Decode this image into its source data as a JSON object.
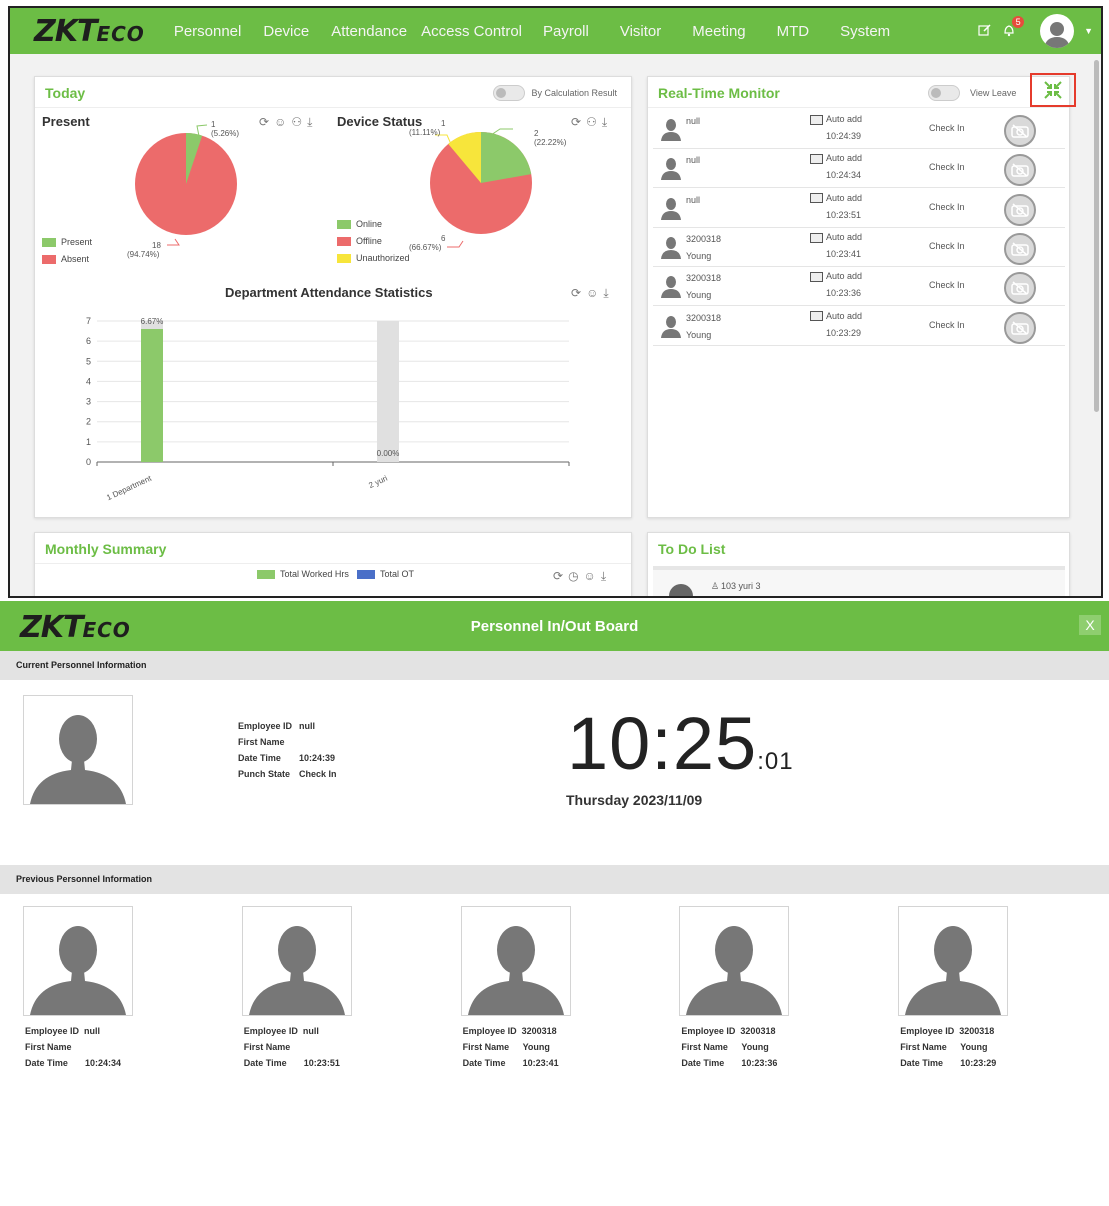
{
  "nav": {
    "logo_main": "ZKT",
    "logo_sub": "ECO",
    "items": [
      "Personnel",
      "Device",
      "Attendance",
      "Access Control",
      "Payroll",
      "Visitor",
      "Meeting",
      "MTD",
      "System"
    ],
    "notification_count": "5"
  },
  "today": {
    "title": "Today",
    "toggle_label": "By Calculation Result",
    "present": {
      "heading": "Present",
      "slices": [
        {
          "label": "1\n(5.26%)",
          "value": 1
        },
        {
          "label": "18\n(94.74%)",
          "value": 18
        }
      ],
      "label_top": "1",
      "label_top_pct": "(5.26%)",
      "label_bottom": "18",
      "label_bottom_pct": "(94.74%)",
      "legend": [
        "Present",
        "Absent"
      ]
    },
    "device_status": {
      "heading": "Device Status",
      "label_a": "1",
      "label_a_pct": "(11.11%)",
      "label_b": "2",
      "label_b_pct": "(22.22%)",
      "label_c": "6",
      "label_c_pct": "(66.67%)",
      "legend": [
        "Online",
        "Offline",
        "Unauthorized"
      ]
    },
    "colors": {
      "green": "#8cc96a",
      "red": "#ec6b6b",
      "yellow": "#f7e53b",
      "grey": "#e0e0e0"
    }
  },
  "dept_stats": {
    "heading": "Department Attendance Statistics",
    "chart_data": {
      "type": "bar",
      "categories": [
        "1 Department",
        "2 yuri"
      ],
      "values": [
        7,
        0
      ],
      "data_labels": [
        "6.67%",
        "0.00%"
      ],
      "ylim": [
        0,
        7
      ],
      "yticks": [
        "0",
        "1",
        "2",
        "3",
        "4",
        "5",
        "6",
        "7"
      ]
    }
  },
  "monitor": {
    "title": "Real-Time Monitor",
    "toggle_label": "View Leave",
    "rows": [
      {
        "name1": "null",
        "name2": "",
        "device": "Auto add",
        "time": "10:24:39",
        "state": "Check In"
      },
      {
        "name1": "null",
        "name2": "",
        "device": "Auto add",
        "time": "10:24:34",
        "state": "Check In"
      },
      {
        "name1": "null",
        "name2": "",
        "device": "Auto add",
        "time": "10:23:51",
        "state": "Check In"
      },
      {
        "name1": "3200318",
        "name2": "Young",
        "device": "Auto add",
        "time": "10:23:41",
        "state": "Check In"
      },
      {
        "name1": "3200318",
        "name2": "Young",
        "device": "Auto add",
        "time": "10:23:36",
        "state": "Check In"
      },
      {
        "name1": "3200318",
        "name2": "Young",
        "device": "Auto add",
        "time": "10:23:29",
        "state": "Check In"
      }
    ]
  },
  "monthly": {
    "title": "Monthly Summary",
    "legend": [
      "Total Worked Hrs",
      "Total OT"
    ],
    "colors": {
      "worked": "#8cc96a",
      "ot": "#4a6fc8"
    }
  },
  "todo": {
    "title": "To Do List",
    "item": "103 yuri 3"
  },
  "board": {
    "logo_main": "ZKT",
    "logo_sub": "ECO",
    "title": "Personnel In/Out Board",
    "close": "X",
    "current_section": "Current Personnel Information",
    "previous_section": "Previous Personnel Information",
    "current": {
      "employee_id_label": "Employee ID",
      "employee_id": "null",
      "first_name_label": "First Name",
      "first_name": "",
      "date_time_label": "Date Time",
      "date_time": "10:24:39",
      "punch_state_label": "Punch State",
      "punch_state": "Check In"
    },
    "clock_hm": "10:25",
    "clock_s": ":01",
    "date": "Thursday 2023/11/09",
    "previous": [
      {
        "employee_id": "null",
        "first_name": "",
        "date_time": "10:24:34"
      },
      {
        "employee_id": "null",
        "first_name": "",
        "date_time": "10:23:51"
      },
      {
        "employee_id": "3200318",
        "first_name": "Young",
        "date_time": "10:23:41"
      },
      {
        "employee_id": "3200318",
        "first_name": "Young",
        "date_time": "10:23:36"
      },
      {
        "employee_id": "3200318",
        "first_name": "Young",
        "date_time": "10:23:29"
      }
    ],
    "labels": {
      "employee_id": "Employee ID",
      "first_name": "First Name",
      "date_time": "Date Time"
    }
  }
}
